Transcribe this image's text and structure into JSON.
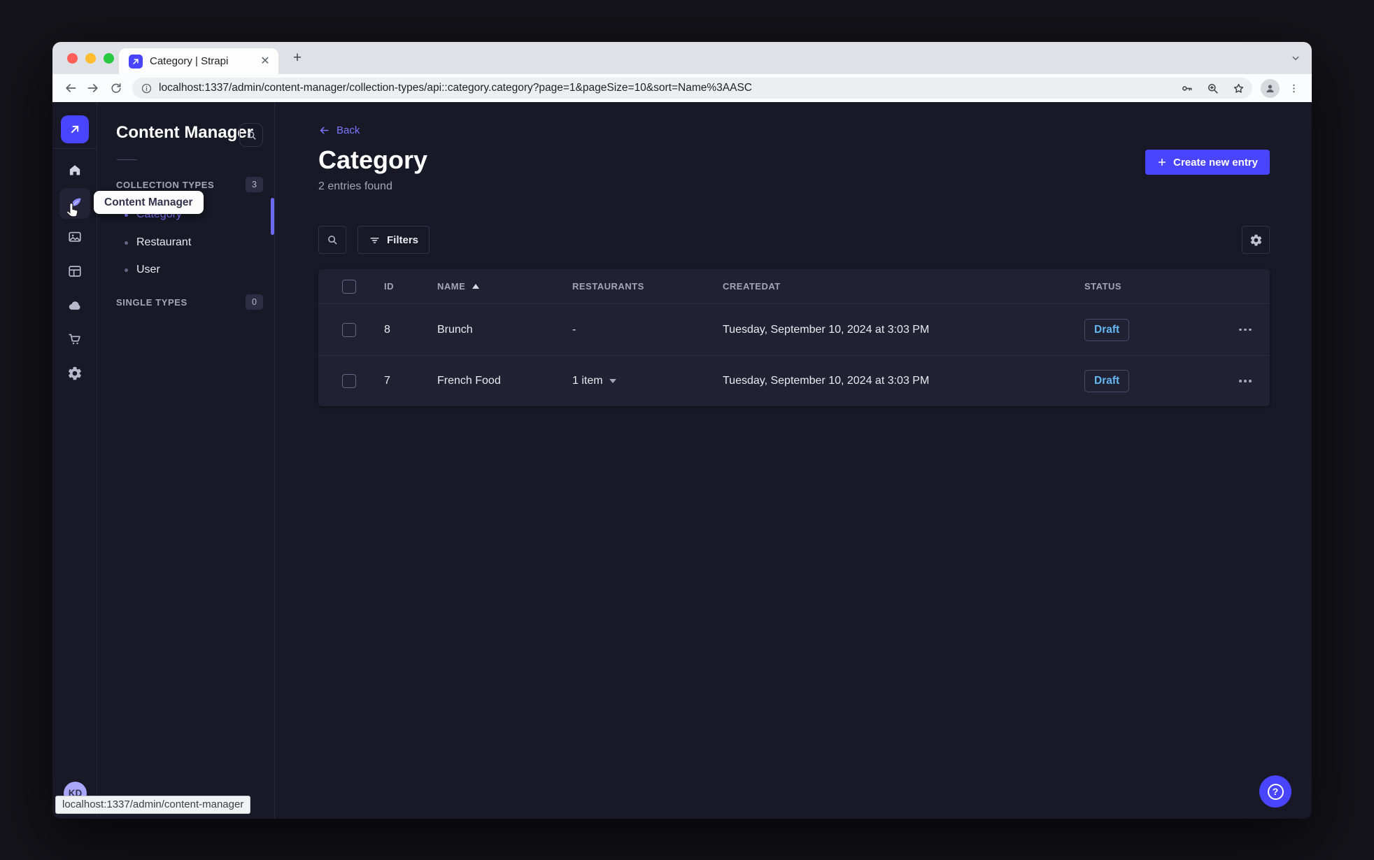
{
  "colors": {
    "accent": "#4945ff",
    "accent_light": "#7b79ff",
    "draft_text": "#66b7f1",
    "app_bg": "#181826",
    "panel_bg": "#212134",
    "border": "#32324d"
  },
  "browser": {
    "tab_title": "Category | Strapi",
    "url": "localhost:1337/admin/content-manager/collection-types/api::category.category?page=1&pageSize=10&sort=Name%3AASC",
    "status_bubble": "localhost:1337/admin/content-manager"
  },
  "nav": {
    "tooltip": "Content Manager",
    "avatar_initials": "KD"
  },
  "subnav": {
    "title": "Content Manager",
    "collection_types": {
      "label": "COLLECTION TYPES",
      "badge": "3",
      "items": [
        {
          "label": "Category"
        },
        {
          "label": "Restaurant"
        },
        {
          "label": "User"
        }
      ]
    },
    "single_types": {
      "label": "SINGLE TYPES",
      "badge": "0"
    }
  },
  "main": {
    "back_label": "Back",
    "title": "Category",
    "subtitle": "2 entries found",
    "create_button_label": "Create new entry",
    "filters_button_label": "Filters",
    "table": {
      "columns": {
        "id": "ID",
        "name": "NAME",
        "restaurants": "RESTAURANTS",
        "createdat": "CREATEDAT",
        "status": "STATUS"
      },
      "rows": [
        {
          "id": "8",
          "name": "Brunch",
          "restaurants": "-",
          "createdat": "Tuesday, September 10, 2024 at 3:03 PM",
          "status": "Draft"
        },
        {
          "id": "7",
          "name": "French Food",
          "restaurants": "1 item",
          "createdat": "Tuesday, September 10, 2024 at 3:03 PM",
          "status": "Draft"
        }
      ]
    }
  }
}
